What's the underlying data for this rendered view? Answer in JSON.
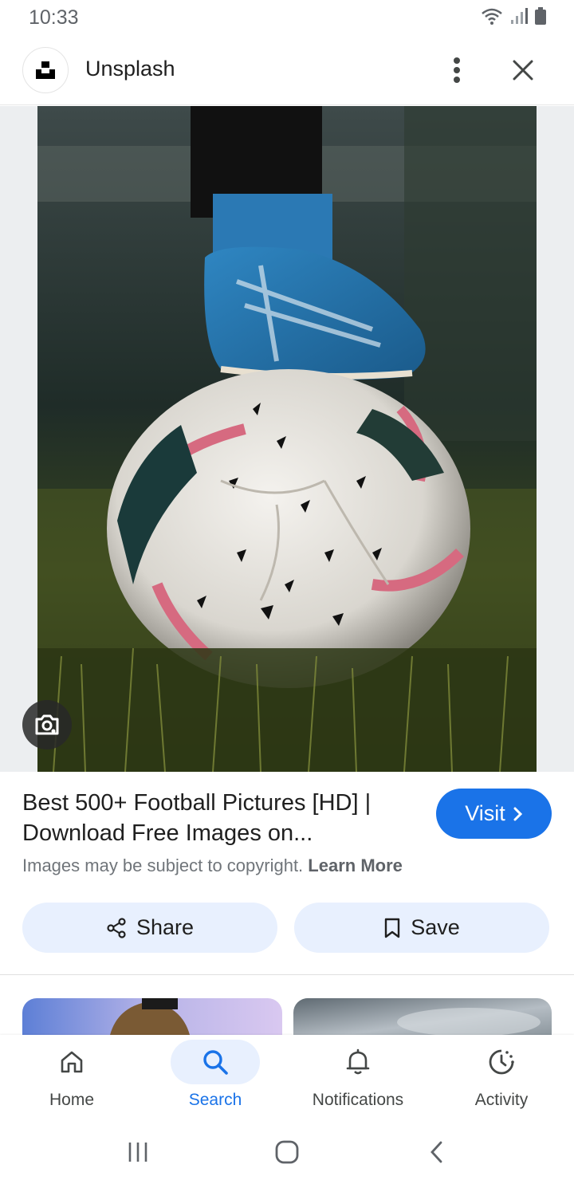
{
  "status_bar": {
    "time": "10:33",
    "icons": [
      "wifi-icon",
      "signal-icon",
      "battery-icon"
    ]
  },
  "header": {
    "site_name": "Unsplash",
    "logo_icon": "unsplash-logo",
    "more_icon": "more-vert-icon",
    "close_icon": "close-icon"
  },
  "result": {
    "title": "Best 500+ Football Pictures [HD] | Download Free Images on...",
    "visit_label": "Visit",
    "copyright_text": "Images may be subject to copyright.",
    "learn_more_label": "Learn More",
    "share_label": "Share",
    "save_label": "Save"
  },
  "bottom_nav": {
    "items": [
      {
        "label": "Home",
        "icon": "home-icon"
      },
      {
        "label": "Search",
        "icon": "search-icon",
        "active": true
      },
      {
        "label": "Notifications",
        "icon": "bell-icon"
      },
      {
        "label": "Activity",
        "icon": "activity-icon"
      }
    ]
  },
  "colors": {
    "accent": "#1a73e8",
    "chip_bg": "#e8f0fe"
  }
}
